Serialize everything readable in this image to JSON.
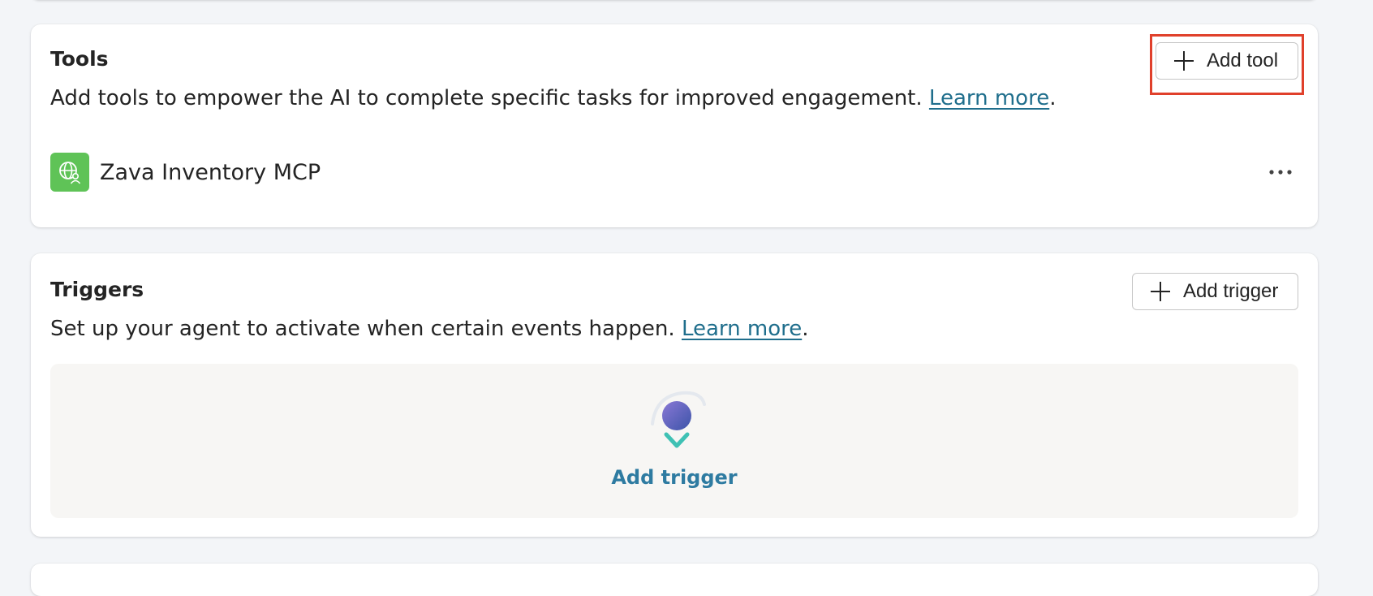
{
  "tools": {
    "title": "Tools",
    "description": "Add tools to empower the AI to complete specific tasks for improved engagement. ",
    "learn_more": "Learn more",
    "period": ".",
    "add_button_label": "Add tool",
    "items": [
      {
        "name": "Zava Inventory MCP",
        "icon": "globe-person-icon"
      }
    ]
  },
  "triggers": {
    "title": "Triggers",
    "description": "Set up your agent to activate when certain events happen. ",
    "learn_more": "Learn more",
    "period": ".",
    "add_button_label": "Add trigger",
    "empty_state_label": "Add trigger",
    "empty_state_icon": "trigger-arrow-icon"
  },
  "colors": {
    "highlight": "#e0402b",
    "link": "#1f6e8c",
    "tool_icon_bg": "#5fc357"
  }
}
